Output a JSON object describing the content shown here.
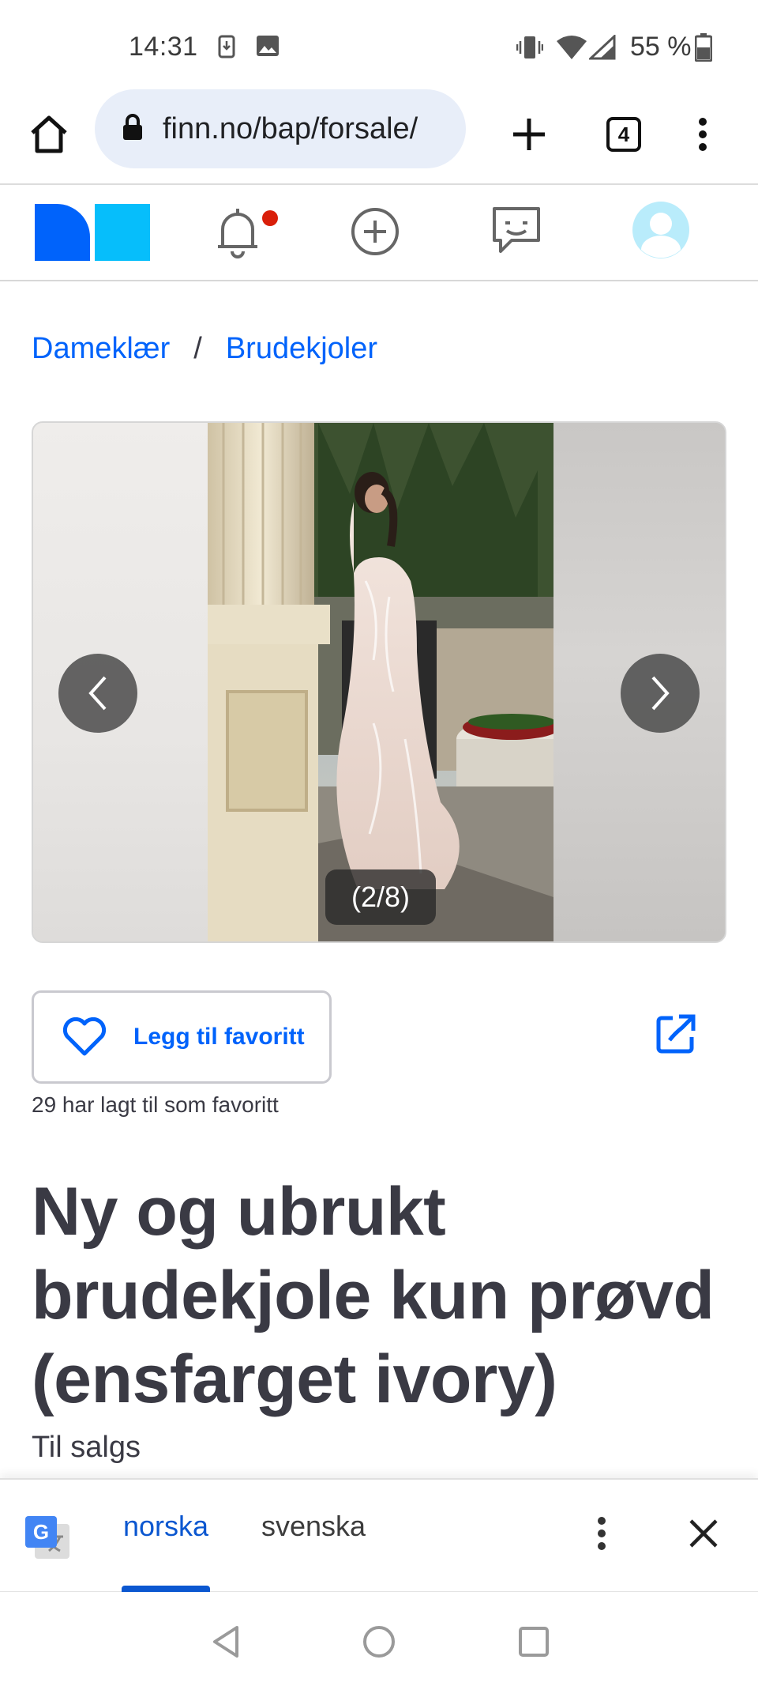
{
  "status_bar": {
    "time": "14:31",
    "battery_percent": "55 %",
    "icons": [
      "download-icon",
      "image-icon",
      "vibrate-icon",
      "wifi-icon",
      "signal-icon",
      "battery-icon"
    ]
  },
  "browser": {
    "url": "finn.no/bap/forsale/",
    "tab_count": "4",
    "icons": [
      "home-icon",
      "lock-icon",
      "new-tab-plus-icon",
      "tabs-icon",
      "menu-dots-icon"
    ]
  },
  "site_nav": {
    "icons": [
      "finn-logo",
      "notifications-bell-icon",
      "new-ad-plus-icon",
      "messages-icon",
      "profile-avatar-icon"
    ],
    "notification_dot_color": "#d91f0a"
  },
  "breadcrumb": {
    "items": [
      "Dameklær",
      "Brudekjoler"
    ],
    "separator": "/"
  },
  "gallery": {
    "counter": "(2/8)",
    "prev_icon": "chevron-left-icon",
    "next_icon": "chevron-right-icon"
  },
  "favorite": {
    "button_label": "Legg til favoritt",
    "count_text": "29 har lagt til som favoritt",
    "icon": "heart-icon",
    "share_icon": "share-icon"
  },
  "ad": {
    "title": "Ny og ubrukt brudekjole kun prøvd (ensfarget ivory)",
    "type": "Til salgs"
  },
  "translate_bar": {
    "languages": [
      "norska",
      "svenska"
    ],
    "active_language": "norska",
    "icons": [
      "google-translate-icon",
      "more-vert-icon",
      "close-icon"
    ]
  },
  "android_nav": {
    "icons": [
      "back-triangle-icon",
      "home-circle-icon",
      "recents-square-icon"
    ]
  },
  "colors": {
    "finn_blue": "#0063fb",
    "finn_logo_dark": "#0063fb",
    "finn_logo_light": "#06befb",
    "translate_blue": "#0b57d0",
    "text_dark": "#3a3a44"
  }
}
